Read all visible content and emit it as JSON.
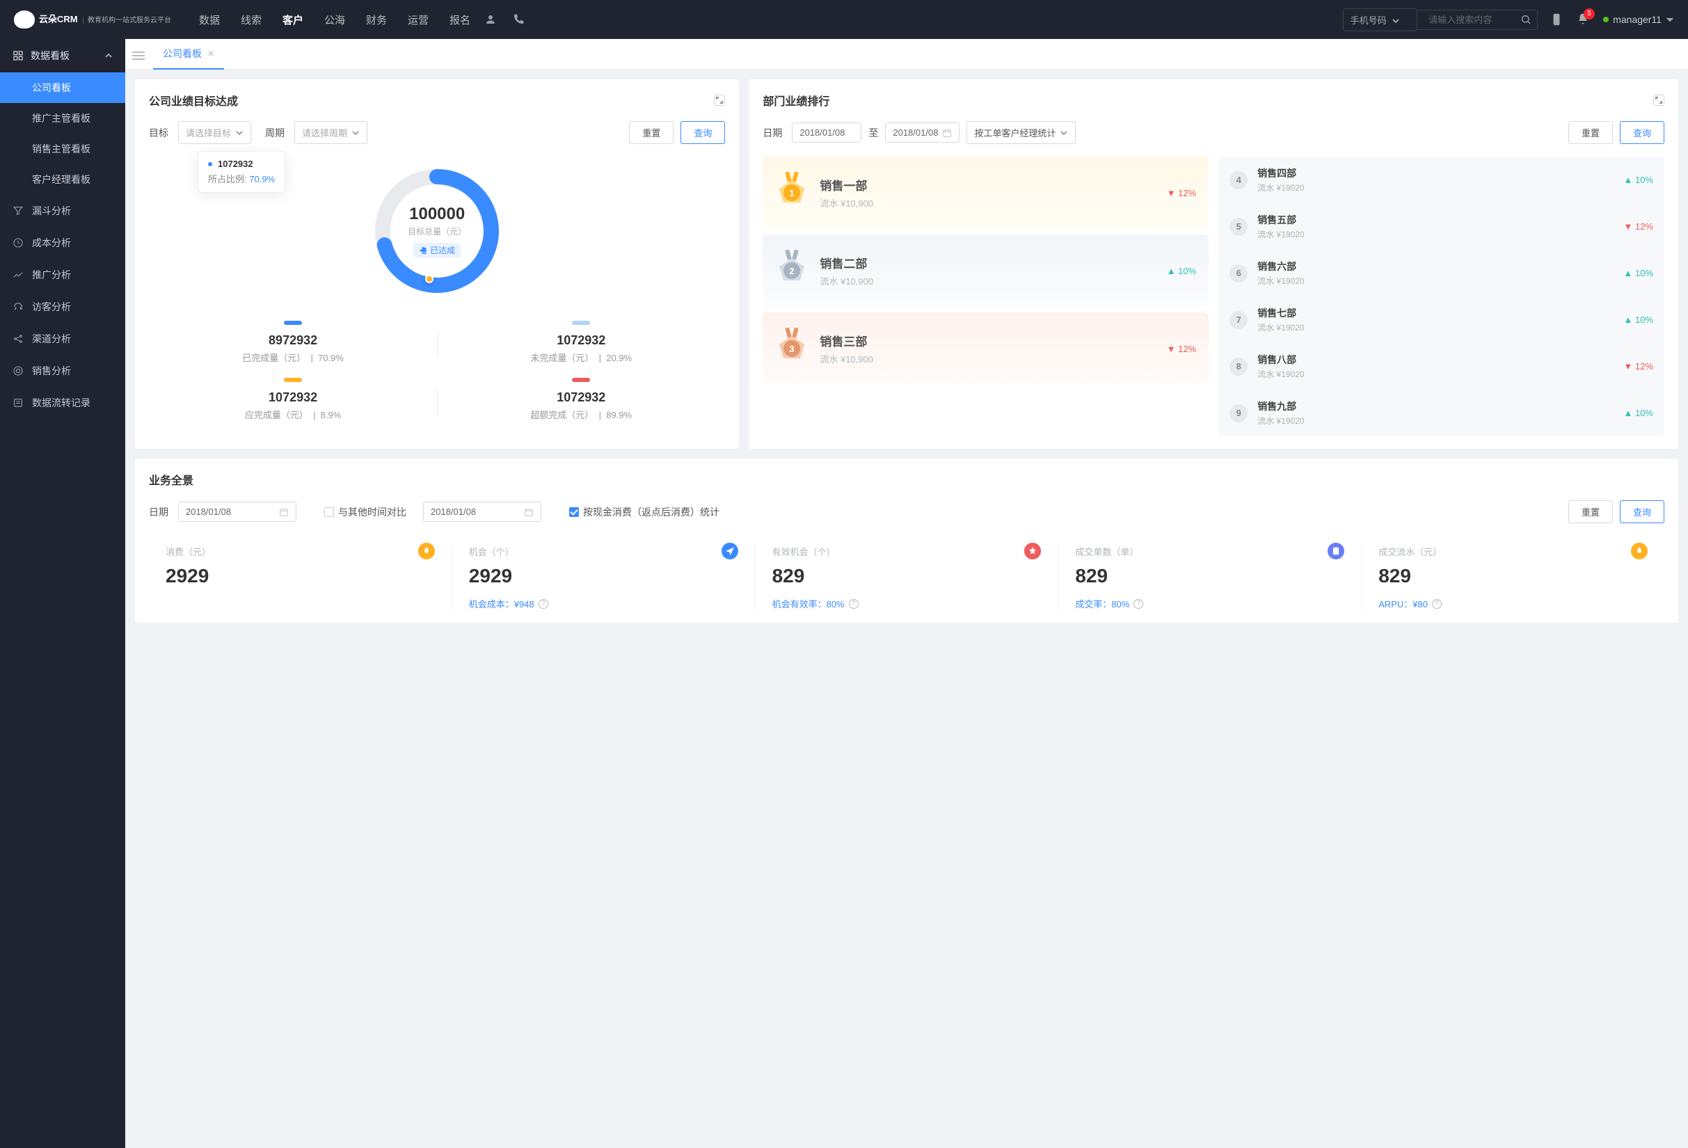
{
  "brand": {
    "main": "云朵CRM",
    "sub": "教育机构一站式服务云平台"
  },
  "nav": [
    "数据",
    "线索",
    "客户",
    "公海",
    "财务",
    "运营",
    "报名"
  ],
  "nav_active": 2,
  "search": {
    "select": "手机号码",
    "placeholder": "请输入搜索内容"
  },
  "notif_count": "5",
  "user": "manager11",
  "sidebar": {
    "group": "数据看板",
    "items": [
      "公司看板",
      "推广主管看板",
      "销售主管看板",
      "客户经理看板"
    ],
    "active": 0,
    "links": [
      "漏斗分析",
      "成本分析",
      "推广分析",
      "访客分析",
      "渠道分析",
      "销售分析",
      "数据流转记录"
    ]
  },
  "tab": "公司看板",
  "goal": {
    "title": "公司业绩目标达成",
    "target_label": "目标",
    "target_ph": "请选择目标",
    "period_label": "周期",
    "period_ph": "请选择周期",
    "reset": "重置",
    "query": "查询",
    "tooltip_value": "1072932",
    "tooltip_label": "所占比例:",
    "tooltip_pct": "70.9%",
    "total": "100000",
    "total_label": "目标总量（元）",
    "achieved": "已达成",
    "metrics": [
      {
        "bar": "#3a8bff",
        "value": "8972932",
        "label": "已完成量（元）",
        "pct": "70.9%"
      },
      {
        "bar": "#b3d3ff",
        "value": "1072932",
        "label": "未完成量（元）",
        "pct": "20.9%"
      },
      {
        "bar": "#ffb020",
        "value": "1072932",
        "label": "应完成量（元）",
        "pct": "8.9%"
      },
      {
        "bar": "#f05b5b",
        "value": "1072932",
        "label": "超额完成（元）",
        "pct": "89.9%"
      }
    ]
  },
  "chart_data": {
    "type": "pie",
    "title": "目标总量（元）",
    "total": 100000,
    "series": [
      {
        "name": "已完成量（元）",
        "value": 8972932,
        "pct": 70.9,
        "color": "#3a8bff"
      },
      {
        "name": "未完成量（元）",
        "value": 1072932,
        "pct": 20.9,
        "color": "#b3d3ff"
      },
      {
        "name": "应完成量（元）",
        "value": 1072932,
        "pct": 8.9,
        "color": "#ffb020"
      },
      {
        "name": "超额完成（元）",
        "value": 1072932,
        "pct": 89.9,
        "color": "#f05b5b"
      }
    ],
    "highlight": {
      "name": "1072932",
      "pct": 70.9
    }
  },
  "rank": {
    "title": "部门业绩排行",
    "date_label": "日期",
    "date_from": "2018/01/08",
    "date_to": "2018/01/08",
    "to": "至",
    "stat_by": "按工单客户经理统计",
    "reset": "重置",
    "query": "查询",
    "top": [
      {
        "name": "销售一部",
        "sub": "流水 ¥10,900",
        "trend": "12%",
        "dir": "down"
      },
      {
        "name": "销售二部",
        "sub": "流水 ¥10,900",
        "trend": "10%",
        "dir": "up"
      },
      {
        "name": "销售三部",
        "sub": "流水 ¥10,900",
        "trend": "12%",
        "dir": "down"
      }
    ],
    "rest": [
      {
        "rank": "4",
        "name": "销售四部",
        "sub": "流水 ¥19020",
        "trend": "10%",
        "dir": "up"
      },
      {
        "rank": "5",
        "name": "销售五部",
        "sub": "流水 ¥19020",
        "trend": "12%",
        "dir": "down"
      },
      {
        "rank": "6",
        "name": "销售六部",
        "sub": "流水 ¥19020",
        "trend": "10%",
        "dir": "up"
      },
      {
        "rank": "7",
        "name": "销售七部",
        "sub": "流水 ¥19020",
        "trend": "10%",
        "dir": "up"
      },
      {
        "rank": "8",
        "name": "销售八部",
        "sub": "流水 ¥19020",
        "trend": "12%",
        "dir": "down"
      },
      {
        "rank": "9",
        "name": "销售九部",
        "sub": "流水 ¥19020",
        "trend": "10%",
        "dir": "up"
      }
    ]
  },
  "overview": {
    "title": "业务全景",
    "date_label": "日期",
    "date": "2018/01/08",
    "compare": "与其他时间对比",
    "date2": "2018/01/08",
    "checkbox": "按现金消费（返点后消费）统计",
    "reset": "重置",
    "query": "查询",
    "items": [
      {
        "label": "消费（元）",
        "value": "2929",
        "icon": "#ffb020",
        "sub": ""
      },
      {
        "label": "机会（个）",
        "value": "2929",
        "icon": "#3a8bff",
        "sub": "机会成本：¥948"
      },
      {
        "label": "有效机会（个）",
        "value": "829",
        "icon": "#f05b5b",
        "sub": "机会有效率：80%"
      },
      {
        "label": "成交单数（单）",
        "value": "829",
        "icon": "#6a7df7",
        "sub": "成交率：80%"
      },
      {
        "label": "成交流水（元）",
        "value": "829",
        "icon": "#ffb020",
        "sub": "ARPU：¥80"
      }
    ]
  }
}
